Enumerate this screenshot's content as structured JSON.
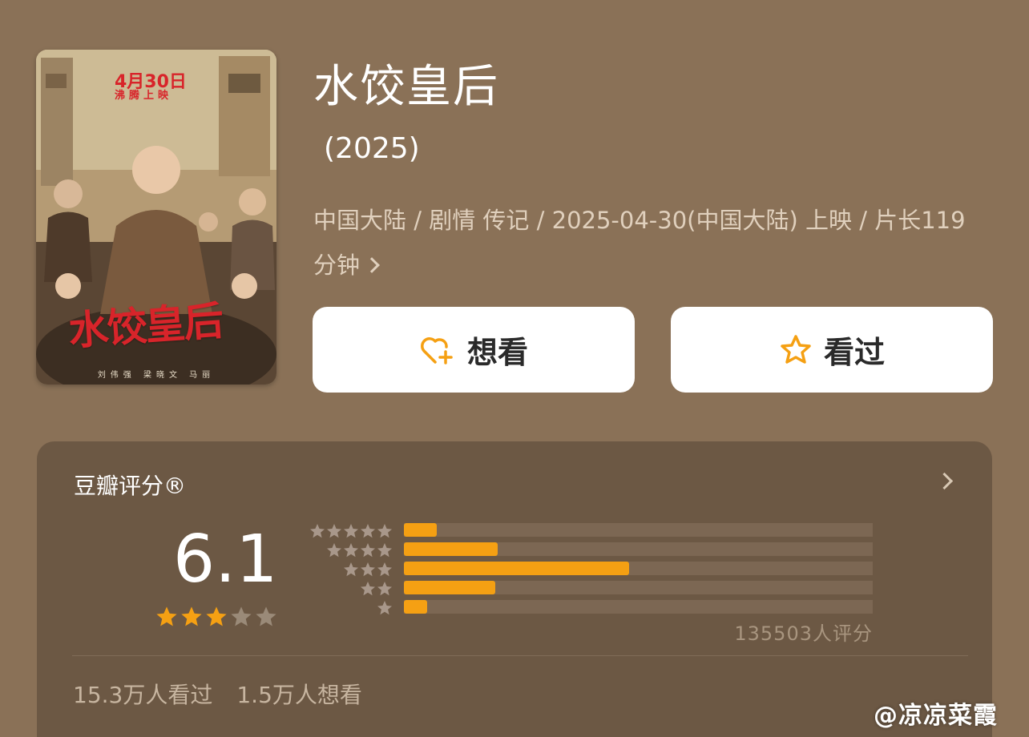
{
  "poster": {
    "date_text": "4月30日",
    "release_text": "沸腾上映",
    "title_art": "水饺皇后",
    "credits": "刘伟强 梁晓文 马丽"
  },
  "movie": {
    "title": "水饺皇后",
    "year": "(2025)",
    "meta": "中国大陆 / 剧情 传记 / 2025-04-30(中国大陆) 上映 / 片长119分钟"
  },
  "actions": {
    "want_label": "想看",
    "want_icon": "heart-plus-icon",
    "seen_label": "看过",
    "seen_icon": "star-outline-icon"
  },
  "rating": {
    "section_title": "豆瓣评分®",
    "score": "6.1",
    "score_stars_filled": 3,
    "score_stars_total": 5,
    "distribution": [
      {
        "stars": 5,
        "fraction": 0.07
      },
      {
        "stars": 4,
        "fraction": 0.2
      },
      {
        "stars": 3,
        "fraction": 0.48
      },
      {
        "stars": 2,
        "fraction": 0.195
      },
      {
        "stars": 1,
        "fraction": 0.05
      }
    ],
    "count_text": "135503人评分"
  },
  "stats": {
    "seen_text": "15.3万人看过",
    "want_text": "1.5万人想看"
  },
  "watermark": "@凉凉菜霞",
  "colors": {
    "accent": "#f5a013",
    "background": "#8a7157",
    "card": "#6c5844"
  }
}
